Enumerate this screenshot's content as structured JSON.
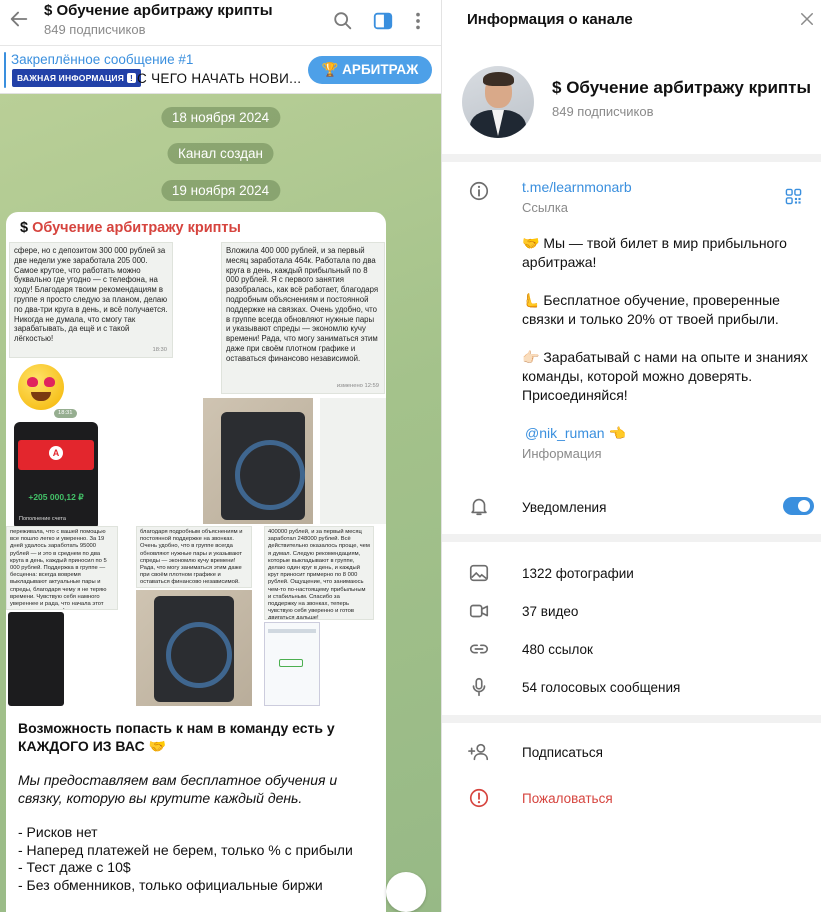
{
  "chat": {
    "title": "Обучение арбитражу крипты",
    "title_prefix": "$",
    "subscribers": "849 подписчиков",
    "pinned": {
      "title": "Закреплённое сообщение #1",
      "badge": "ВАЖНАЯ ИНФОРМАЦИЯ",
      "badge_mark": "!",
      "text": "С ЧЕГО НАЧАТЬ НОВИ...",
      "button": "🏆 АРБИТРАЖ"
    },
    "date_pills": [
      "18 ноября 2024",
      "Канал создан",
      "19 ноября 2024"
    ],
    "message": {
      "sender": "Обучение арбитражу крипты",
      "sender_prefix": "$",
      "shot1": "сфере, но с депозитом 300 000 рублей за две недели уже заработала 205 000. Самое крутое, что работать можно буквально где угодно — с телефона, на ходу! Благодаря твоим рекомендациям в группе я просто следую за планом, делаю по два-три круга в день, и всё получается. Никогда не думала, что смогу так зарабатывать, да ещё и с такой лёгкостью!",
      "shot1_time": "18:30",
      "shot2": "Вложила 400 000 рублей, и за первый месяц заработала 464к. Работала по два круга в день, каждый прибыльный по 8 000 рублей. Я с первого занятия разобралась, как всё работает, благодаря подробным объяснениям и постоянной поддержке на связках. Очень удобно, что в группе всегда обновляют нужные пары и указывают спреды — экономлю кучу времени! Рада, что могу заниматься этим даже при своём плотном графике и оставаться финансово независимой.",
      "shot2_time": "изменено 12:59",
      "sticker_time": "18:31",
      "bank_amount": "+205 000,12 ₽",
      "bank_label": "Пополнение счета",
      "shot3": "переживала, что с вашей помощью все пошло легко и уверенно. За 19 дней удалось заработать 95000 рублей — и это в среднем по два круга в день, каждый приносил по 5 000 рублей. Поддержка в группе — бесценна: всегда вовремя выкладывают актуальные пары и спреды, благодаря чему я не теряю времени. Чувствую себя намного увереннее и рада, что начала этот путь именно с вами!",
      "shot4": "благодаря подробным объяснениям и постоянной поддержке на звонках. Очень удобно, что в группе всегда обновляют нужные пары и указывают спреды — экономлю кучу времени! Рада, что могу заниматься этим даже при своём плотном графике и оставаться финансово независимой.",
      "shot5": "400000 рублей, и за первый месяц заработал 248000 рублей. Всё действительно оказалось проще, чем я думал. Следую рекомендациям, которые выкладывают в группе, делаю один круг в день, и каждый круг приносит примерно по 8 000 рублей. Ощущение, что занимаюсь чем-то по-настоящему прибыльным и стабильным. Спасибо за поддержку на звонках, теперь чувствую себя уверенно и готов двигаться дальше!",
      "text_headline": "Возможность попасть к нам в команду есть у КАЖДОГО ИЗ ВАС 🤝",
      "text_italic": "Мы предоставляем вам бесплатное обучения и связку, которую вы крутите каждый день.",
      "text_list": [
        "- Рисков нет",
        "- Наперед платежей не берем, только % с прибыли",
        "- Тест даже с 10$",
        "- Без обменников, только официальные биржи"
      ]
    }
  },
  "info": {
    "title": "Информация о канале",
    "channel_name": "Обучение арбитражу крипты",
    "channel_prefix": "$",
    "subscribers": "849 подписчиков",
    "link": "t.me/learnmonarb",
    "link_label": "Ссылка",
    "description": [
      "🤝 Мы — твой билет в мир прибыльного арбитража!",
      "🫷 Бесплатное обучение, проверенные связки и только 20% от твоей прибыли.",
      "👉🏻 Зарабатывай с нами на опыте и знаниях команды, которой можно доверять. Присоединяйся!"
    ],
    "mention": "@nik_ruman",
    "mention_emoji": "👈",
    "description_label": "Информация",
    "notifications_label": "Уведомления",
    "notifications_on": true,
    "media": [
      {
        "icon": "photo-icon",
        "label": "1322 фотографии"
      },
      {
        "icon": "video-icon",
        "label": "37 видео"
      },
      {
        "icon": "link-icon",
        "label": "480 ссылок"
      },
      {
        "icon": "microphone-icon",
        "label": "54 голосовых сообщения"
      }
    ],
    "actions": {
      "subscribe": "Подписаться",
      "report": "Пожаловаться"
    },
    "colors": {
      "accent": "#3a8fde",
      "danger": "#d6443e",
      "chat_bg": "#a4c28b"
    }
  }
}
